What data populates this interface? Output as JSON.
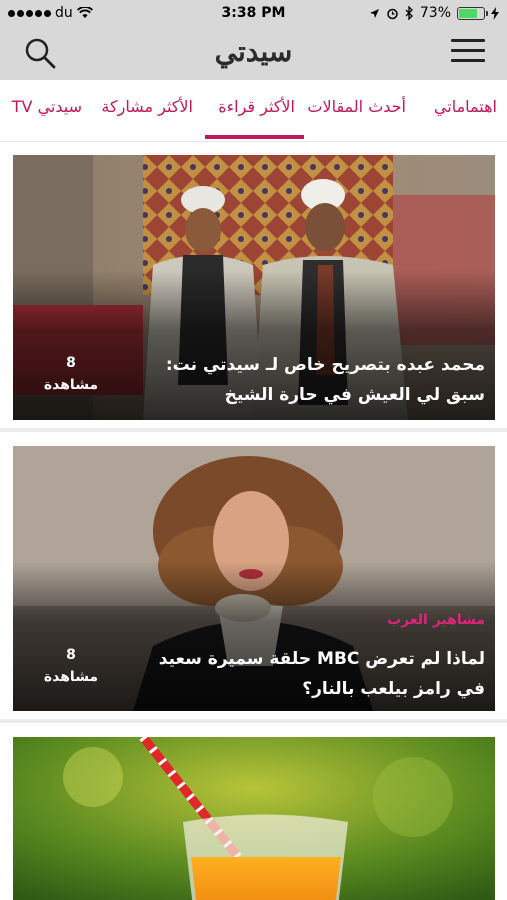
{
  "status_bar": {
    "carrier": "du",
    "time": "3:38 PM",
    "battery_percent": "73%",
    "battery_level": 0.73
  },
  "header": {
    "logo_main": "سيدتي",
    "icons": {
      "search": "search-icon",
      "menu": "hamburger-menu-icon"
    }
  },
  "tabs": [
    {
      "label": "اهتماماتي"
    },
    {
      "label": "أحدث المقالات"
    },
    {
      "label": "الأكثر قراءة",
      "active": true
    },
    {
      "label": "الأكثر مشاركة"
    },
    {
      "label": "سيدتي TV"
    }
  ],
  "articles": [
    {
      "category": "",
      "title": "محمد عبده بتصريح خاص لـ سيدتي نت: سبق لي العيش في حارة الشيخ",
      "views_count": "8",
      "views_label": "مشاهدة"
    },
    {
      "category": "مشاهير العرب",
      "title": "لماذا لم تعرض MBC حلقة سميرة سعيد في رامز بيلعب بالنار؟",
      "views_count": "8",
      "views_label": "مشاهدة"
    },
    {
      "category": "",
      "title": "",
      "views_count": "",
      "views_label": ""
    }
  ],
  "colors": {
    "accent": "#c2185b",
    "header_bg": "#d8d8d8",
    "category": "#e0247a"
  }
}
